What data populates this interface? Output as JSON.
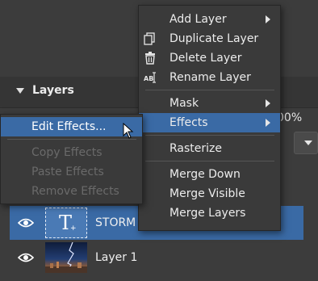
{
  "layers_panel": {
    "title": "Layers",
    "opacity_fragment": "00%",
    "layers": [
      {
        "name": "STORM",
        "type": "text",
        "selected": true
      },
      {
        "name": "Layer 1",
        "type": "image",
        "selected": false
      }
    ]
  },
  "context_menu": {
    "items": [
      {
        "label": "Add Layer",
        "icon": "",
        "submenu": true
      },
      {
        "label": "Duplicate Layer",
        "icon": "duplicate-icon",
        "submenu": false
      },
      {
        "label": "Delete Layer",
        "icon": "trash-icon",
        "submenu": false
      },
      {
        "label": "Rename Layer",
        "icon": "rename-icon",
        "submenu": false
      },
      {
        "label": "Mask",
        "icon": "",
        "submenu": true
      },
      {
        "label": "Effects",
        "icon": "",
        "submenu": true,
        "highlighted": true
      },
      {
        "label": "Rasterize",
        "icon": "",
        "submenu": false
      },
      {
        "label": "Merge Down",
        "icon": "",
        "submenu": false
      },
      {
        "label": "Merge Visible",
        "icon": "",
        "submenu": false
      },
      {
        "label": "Merge Layers",
        "icon": "",
        "submenu": false
      }
    ]
  },
  "effects_submenu": {
    "items": [
      {
        "label": "Edit Effects...",
        "enabled": true,
        "highlighted": true
      },
      {
        "label": "Copy Effects",
        "enabled": false
      },
      {
        "label": "Paste Effects",
        "enabled": false
      },
      {
        "label": "Remove Effects",
        "enabled": false
      }
    ]
  },
  "colors": {
    "background": "#3c3c3c",
    "highlight": "#3a6aa5",
    "menu_bg": "#3a3a3a",
    "disabled_text": "#6a6a6a"
  }
}
